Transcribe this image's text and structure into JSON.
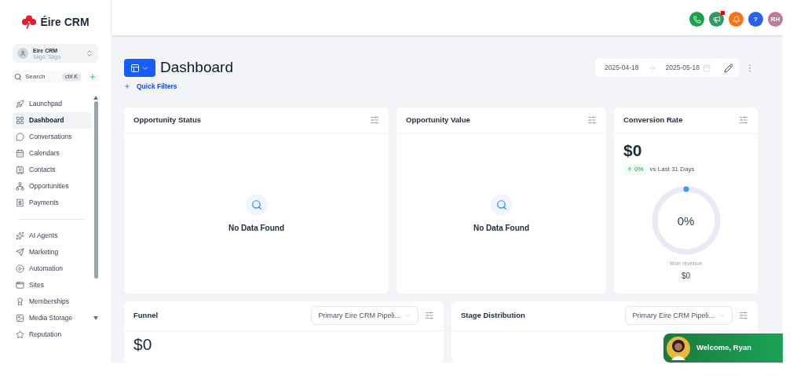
{
  "brand": {
    "name": "Éire CRM"
  },
  "account": {
    "name": "Eire CRM",
    "location": "Sligo, Sligo"
  },
  "search": {
    "placeholder": "Search",
    "shortcut": "ctrl K"
  },
  "nav_groups": [
    [
      {
        "label": "Launchpad",
        "selected": false
      },
      {
        "label": "Dashboard",
        "selected": true
      },
      {
        "label": "Conversations",
        "selected": false
      },
      {
        "label": "Calendars",
        "selected": false
      },
      {
        "label": "Contacts",
        "selected": false
      },
      {
        "label": "Opportunities",
        "selected": false
      },
      {
        "label": "Payments",
        "selected": false
      }
    ],
    [
      {
        "label": "AI Agents",
        "selected": false
      },
      {
        "label": "Marketing",
        "selected": false
      },
      {
        "label": "Automation",
        "selected": false
      },
      {
        "label": "Sites",
        "selected": false
      },
      {
        "label": "Memberships",
        "selected": false
      },
      {
        "label": "Media Storage",
        "selected": false
      },
      {
        "label": "Reputation",
        "selected": false
      }
    ]
  ],
  "header_actions": [
    {
      "kind": "phone",
      "color": "#16a34a"
    },
    {
      "kind": "megaphone",
      "color": "#2f9a62",
      "badge": true
    },
    {
      "kind": "bell",
      "color": "#f97316"
    },
    {
      "kind": "help",
      "color": "#2563eb",
      "label": "?"
    },
    {
      "kind": "avatar",
      "color": "#c07a98",
      "label": "RH"
    }
  ],
  "page": {
    "title": "Dashboard",
    "quick_filters": "Quick Filters",
    "date_from": "2025-04-18",
    "date_to": "2025-05-18"
  },
  "widgets_row1": [
    {
      "kind": "empty",
      "title": "Opportunity Status",
      "message": "No Data Found"
    },
    {
      "kind": "empty",
      "title": "Opportunity Value",
      "message": "No Data Found"
    },
    {
      "kind": "rate",
      "title": "Conversion Rate",
      "value": "$0",
      "change": "0%",
      "comparison": "vs Last 31 Days",
      "gauge": "0%",
      "caption": "Won revenue",
      "caption_value": "$0"
    }
  ],
  "widgets_row2": [
    {
      "title": "Funnel",
      "pipeline": "Primary Eire CRM Pipeli...",
      "value": "$0"
    },
    {
      "title": "Stage Distribution",
      "pipeline": "Primary Eire CRM Pipeli..."
    }
  ],
  "welcome": {
    "text": "Welcome, Ryan"
  }
}
